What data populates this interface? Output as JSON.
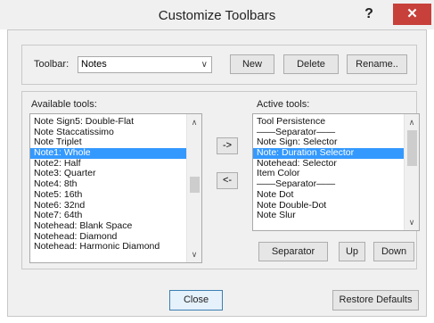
{
  "window": {
    "title": "Customize Toolbars",
    "help_label": "?",
    "close_label": "✕"
  },
  "toolbar_row": {
    "label": "Toolbar:",
    "selected": "Notes",
    "new_label": "New",
    "delete_label": "Delete",
    "rename_label": "Rename.."
  },
  "available": {
    "label": "Available tools:",
    "items": [
      "Note Sign5: Double-Flat",
      "Note Staccatissimo",
      "Note Triplet",
      "Note1: Whole",
      "Note2: Half",
      "Note3: Quarter",
      "Note4: 8th",
      "Note5: 16th",
      "Note6: 32nd",
      "Note7: 64th",
      "Notehead: Blank Space",
      "Notehead: Diamond",
      "Notehead: Harmonic Diamond"
    ],
    "selected_index": 3,
    "scroll_position": 0.62
  },
  "transfer": {
    "add_label": "->",
    "remove_label": "<-"
  },
  "active": {
    "label": "Active tools:",
    "items": [
      "Tool Persistence",
      "——Separator——",
      "Note Sign: Selector",
      "Note: Duration Selector",
      "Notehead: Selector",
      "Item Color",
      "——Separator——",
      "Note Dot",
      "Note Double-Dot",
      "Note Slur"
    ],
    "selected_index": 3,
    "scroll_position": 0.1,
    "separator_label": "Separator",
    "up_label": "Up",
    "down_label": "Down"
  },
  "footer": {
    "close_label": "Close",
    "restore_label": "Restore Defaults"
  }
}
